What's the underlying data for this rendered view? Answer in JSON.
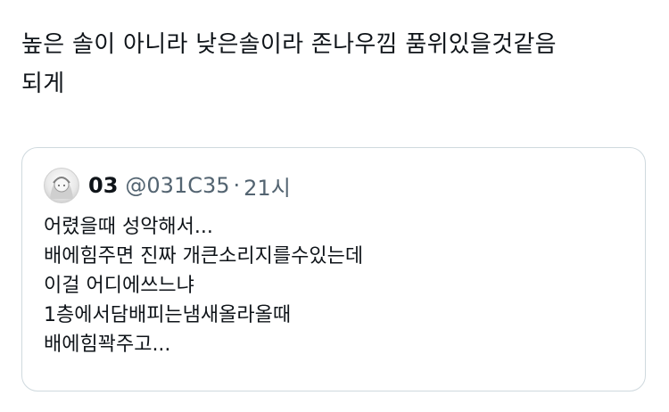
{
  "tweet": {
    "text": "높은 솔이 아니라 낮은솔이라 존나우낌 품위있을것같음\n되게"
  },
  "quoted_tweet": {
    "display_name": "03",
    "handle": "@031C35",
    "separator": "·",
    "timestamp": "21시",
    "lines": [
      "어렸을때 성악해서...",
      "배에힘주면 진짜 개큰소리지를수있는데",
      "이걸 어디에쓰느냐",
      "1층에서담배피는냄새올라올때",
      "배에힘꽉주고..."
    ]
  }
}
